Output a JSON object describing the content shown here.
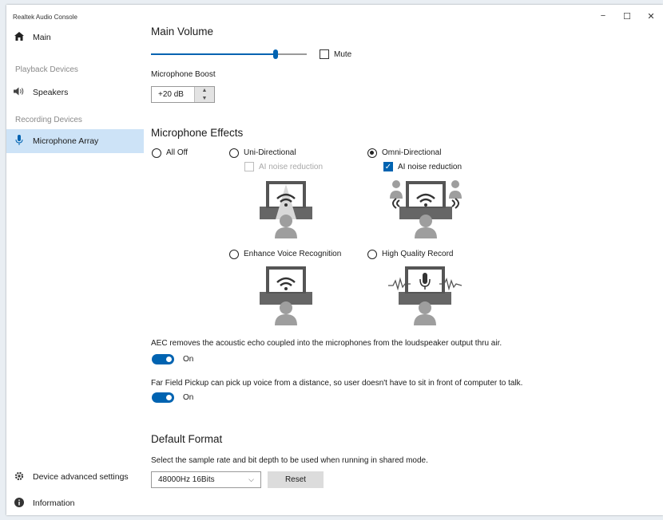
{
  "app": {
    "title": "Realtek Audio Console"
  },
  "caption": {
    "minimize": "−",
    "maximize": "☐",
    "close": "✕"
  },
  "sidebar": {
    "main_label": "Main",
    "playback_section": "Playback Devices",
    "speakers_label": "Speakers",
    "recording_section": "Recording Devices",
    "mic_array_label": "Microphone Array",
    "device_advanced_label": "Device advanced settings",
    "information_label": "Information",
    "icons": {
      "main": "home-icon",
      "speakers": "speaker-icon",
      "mic": "microphone-icon",
      "device_advanced": "gear-icon",
      "information": "info-icon"
    }
  },
  "main_volume": {
    "title": "Main Volume",
    "level_fraction": 0.8,
    "mute_label": "Mute",
    "muted": false
  },
  "mic_boost": {
    "label": "Microphone Boost",
    "value": "+20 dB"
  },
  "effects": {
    "title": "Microphone Effects",
    "all_off": "All Off",
    "uni_directional": "Uni-Directional",
    "uni_ai_noise": "AI noise reduction",
    "omni_directional": "Omni-Directional",
    "omni_ai_noise": "AI noise reduction",
    "enhance_voice": "Enhance Voice Recognition",
    "high_quality": "High Quality Record",
    "selected": "Omni-Directional"
  },
  "aec": {
    "description": "AEC removes the acoustic echo coupled into the microphones from the loudspeaker output thru air.",
    "state": "On"
  },
  "far_field": {
    "description": "Far Field Pickup can pick up voice from a distance, so user doesn't have to sit in front of computer to talk.",
    "state": "On"
  },
  "default_format": {
    "title": "Default Format",
    "description": "Select the sample rate and bit depth to be used when running in shared mode.",
    "selected": "48000Hz 16Bits",
    "reset_label": "Reset"
  },
  "colors": {
    "accent": "#0063b1",
    "selected_nav": "#cde3f7",
    "illustration_gray": "#a6a6a6",
    "illustration_dark": "#555555"
  }
}
